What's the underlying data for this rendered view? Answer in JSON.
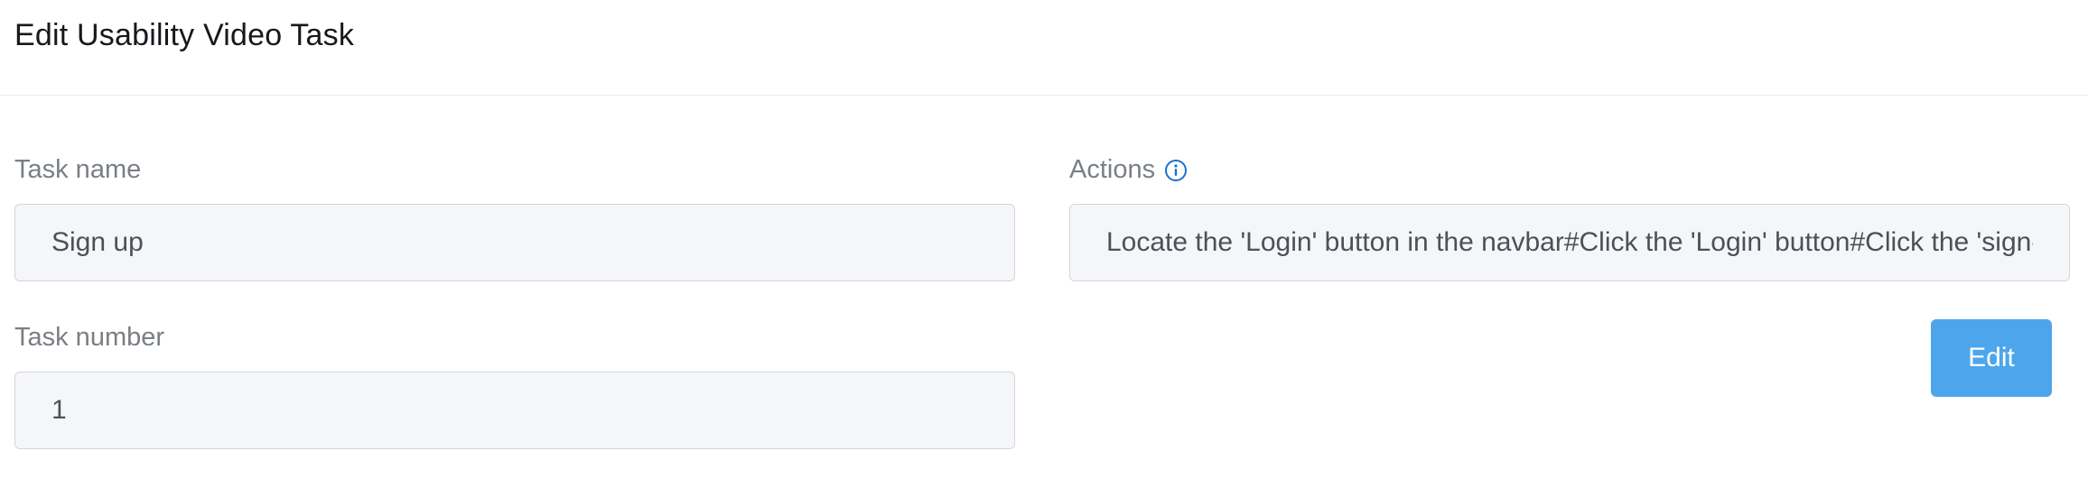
{
  "header": {
    "title": "Edit Usability Video Task"
  },
  "form": {
    "task_name": {
      "label": "Task name",
      "value": "Sign up"
    },
    "task_number": {
      "label": "Task number",
      "value": "1"
    },
    "actions": {
      "label": "Actions",
      "info_icon": "info-circle-icon",
      "value": "Locate the 'Login' button in the navbar#Click the 'Login' button#Click the 'sign-up' link"
    },
    "edit_button_label": "Edit"
  },
  "colors": {
    "accent": "#4da6ec",
    "info_icon": "#1c6fd1",
    "input_bg": "#f5f6f9",
    "label": "#7a7f85"
  }
}
